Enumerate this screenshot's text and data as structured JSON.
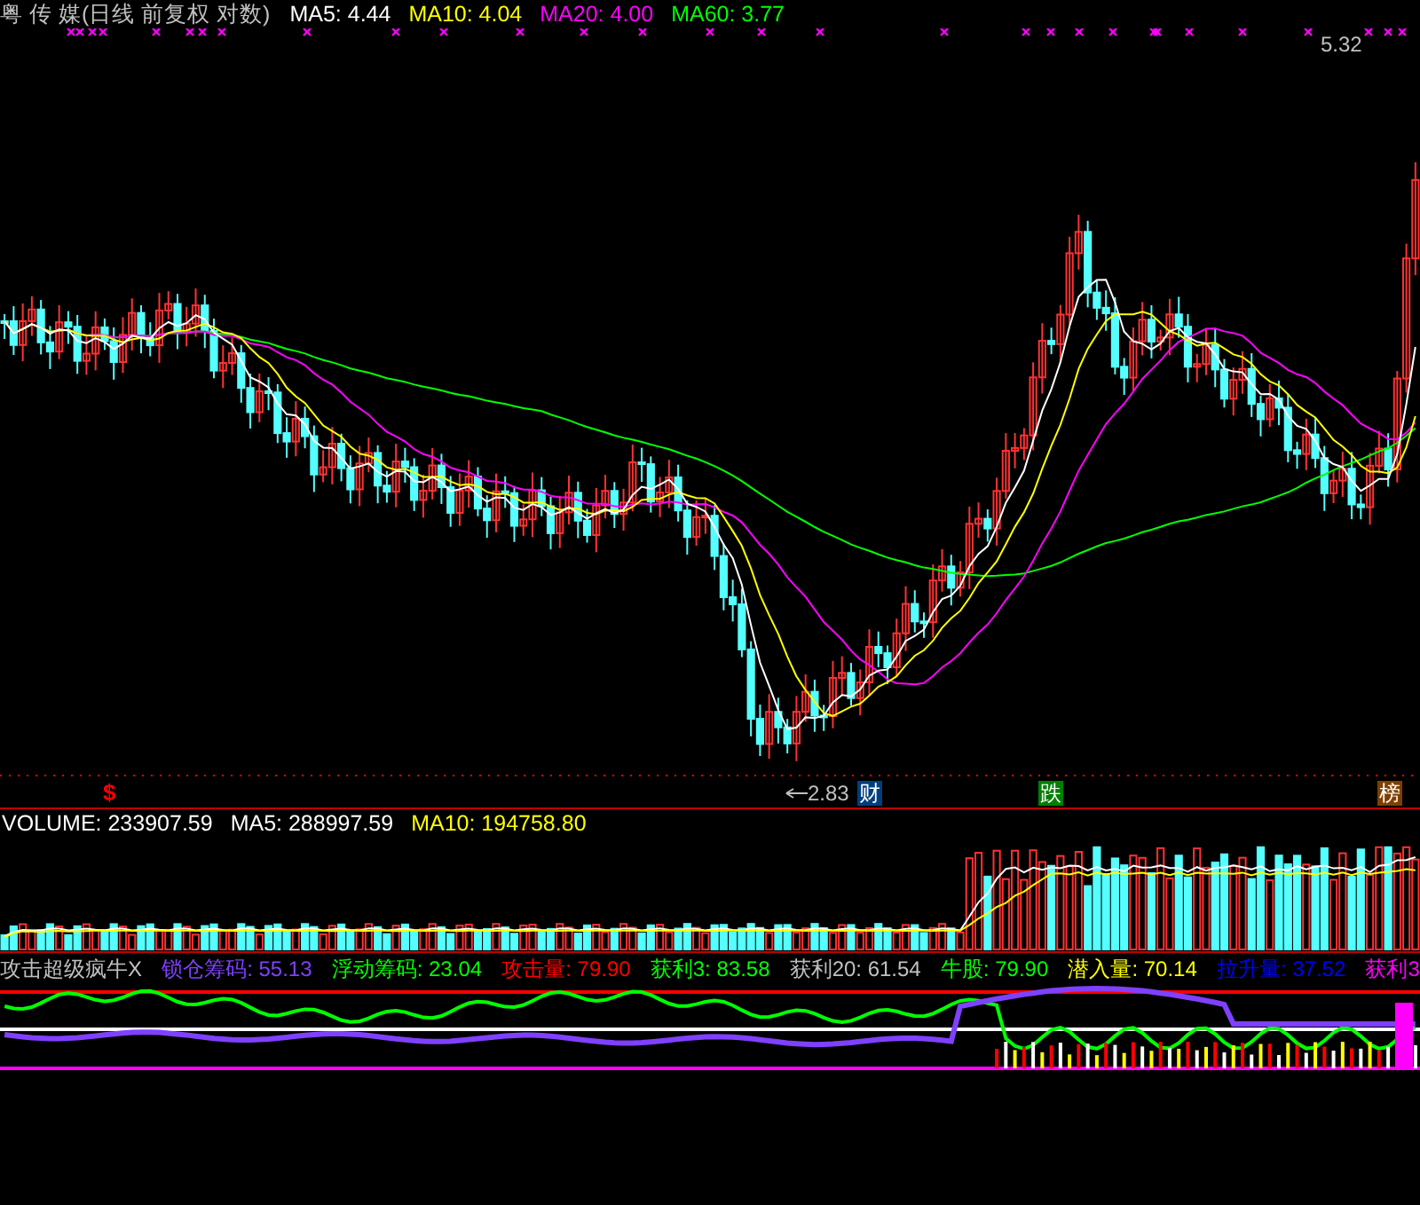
{
  "main_chart": {
    "title": "粤 传 媒(日线 前复权 对数)",
    "indicators": [
      {
        "label": "MA5: 4.44",
        "color": "#ffffff"
      },
      {
        "label": "MA10: 4.04",
        "color": "#ffff00"
      },
      {
        "label": "MA20: 4.00",
        "color": "#ff00ff"
      },
      {
        "label": "MA60: 3.77",
        "color": "#00ff00"
      }
    ],
    "high_label": "5.32",
    "low_label": "2.83",
    "signals": [
      {
        "text": "$",
        "kind": "plain",
        "color": "#ff0000"
      },
      {
        "text": "财",
        "kind": "badge",
        "color": "#003f7f"
      },
      {
        "text": "跌",
        "kind": "badge",
        "color": "#007f00"
      },
      {
        "text": "榜",
        "kind": "badge",
        "color": "#7f3f00"
      }
    ]
  },
  "volume_chart": {
    "indicators": [
      {
        "label": "VOLUME: 233907.59",
        "color": "#ffffff"
      },
      {
        "label": "MA5: 288997.59",
        "color": "#ffffff"
      },
      {
        "label": "MA10: 194758.80",
        "color": "#ffff00"
      }
    ]
  },
  "indicator_chart": {
    "title": "攻击超级疯牛X",
    "indicators": [
      {
        "label": "锁仓筹码: 55.13",
        "color": "#8040ff"
      },
      {
        "label": "浮动筹码: 23.04",
        "color": "#00ff00"
      },
      {
        "label": "攻击量: 79.90",
        "color": "#ff0000"
      },
      {
        "label": "获利3: 83.58",
        "color": "#00ff00"
      },
      {
        "label": "获利20: 61.54",
        "color": "#c0c0c0"
      },
      {
        "label": "牛股: 79.90",
        "color": "#00ff00"
      },
      {
        "label": "潜入量: 70.14",
        "color": "#ffff00"
      },
      {
        "label": "拉升量: 37.52",
        "color": "#0000ff"
      },
      {
        "label": "获利3",
        "color": "#ff00ff"
      }
    ]
  }
}
